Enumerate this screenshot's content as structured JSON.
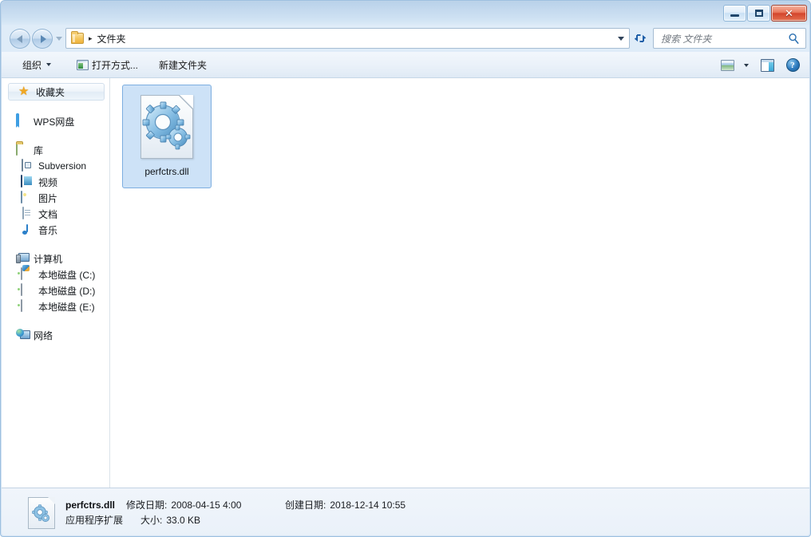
{
  "window": {
    "buttons": {
      "minimize": "—",
      "maximize": "□",
      "close": "✕"
    }
  },
  "address": {
    "back_icon": "back-arrow-icon",
    "forward_icon": "forward-arrow-icon",
    "history_icon": "recent-pages-icon",
    "folder_icon": "folder-icon",
    "separator": "▸",
    "crumb": "文件夹",
    "dropdown_icon": "chevron-down-icon",
    "refresh_icon": "↻",
    "refresh_glyph": "⟳"
  },
  "search": {
    "placeholder": "搜索 文件夹",
    "icon": "search-icon"
  },
  "toolbar": {
    "organize": "组织",
    "open_with": "打开方式...",
    "new_folder": "新建文件夹",
    "views_icon": "views-icon",
    "views_caret_icon": "chevron-down-icon",
    "preview_pane_icon": "preview-pane-icon",
    "help_icon": "help-icon",
    "help_glyph": "?"
  },
  "sidebar": {
    "groups": [
      {
        "header": {
          "label": "收藏夹",
          "icon": "star-icon"
        },
        "items": []
      },
      {
        "header": {
          "label": "WPS网盘",
          "icon": "cloud-icon"
        },
        "items": []
      },
      {
        "header": {
          "label": "库",
          "icon": "library-icon"
        },
        "items": [
          {
            "label": "Subversion",
            "icon": "subversion-icon"
          },
          {
            "label": "视频",
            "icon": "video-icon"
          },
          {
            "label": "图片",
            "icon": "pictures-icon"
          },
          {
            "label": "文档",
            "icon": "documents-icon"
          },
          {
            "label": "音乐",
            "icon": "music-icon"
          }
        ]
      },
      {
        "header": {
          "label": "计算机",
          "icon": "computer-icon"
        },
        "items": [
          {
            "label": "本地磁盘 (C:)",
            "icon": "system-drive-icon"
          },
          {
            "label": "本地磁盘 (D:)",
            "icon": "drive-icon"
          },
          {
            "label": "本地磁盘 (E:)",
            "icon": "drive-icon"
          }
        ]
      },
      {
        "header": {
          "label": "网络",
          "icon": "network-icon"
        },
        "items": []
      }
    ]
  },
  "files": [
    {
      "name": "perfctrs.dll",
      "icon": "dll-gears-icon",
      "selected": true
    }
  ],
  "statusbar": {
    "icon": "dll-gears-icon",
    "file_name": "perfctrs.dll",
    "modified_label": "修改日期:",
    "modified_value": "2008-04-15 4:00",
    "created_label": "创建日期:",
    "created_value": "2018-12-14 10:55",
    "type": "应用程序扩展",
    "size_label": "大小:",
    "size_value": "33.0 KB"
  },
  "colors": {
    "frame": "#c4d9ee",
    "selection": "#cde2f7",
    "selection_border": "#7daee0",
    "accent": "#1f5fa8",
    "close_button": "#d3452c"
  }
}
